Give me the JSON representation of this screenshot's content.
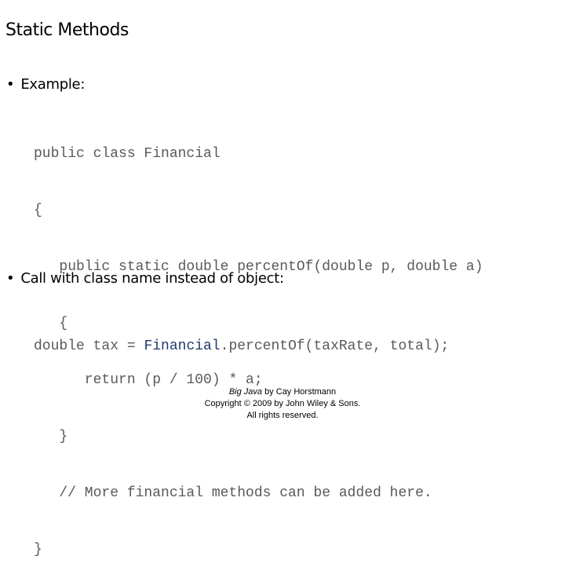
{
  "title": "Static Methods",
  "bullets": [
    {
      "text": "Example:"
    },
    {
      "text": "Call with class name instead of object:"
    }
  ],
  "code_example": [
    "public class Financial",
    "{",
    "   public static double percentOf(double p, double a)",
    "   {",
    "      return (p / 100) * a;",
    "   }",
    "   // More financial methods can be added here.",
    "}"
  ],
  "code_call": {
    "before": "double tax = ",
    "class_name": "Financial",
    "after": ".percentOf(taxRate, total);"
  },
  "footer": {
    "book": "Big Java",
    "author": " by Cay Horstmann",
    "copyright": "Copyright © 2009 by John Wiley & Sons.",
    "rights": "All rights reserved."
  },
  "colors": {
    "code_text": "#595959",
    "class_highlight": "#1f3a6e"
  }
}
